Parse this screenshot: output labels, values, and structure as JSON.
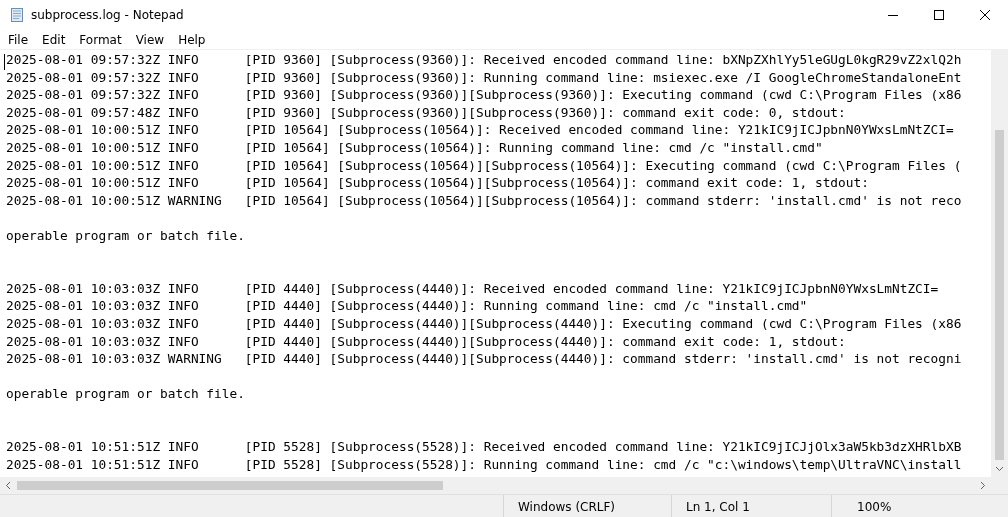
{
  "window": {
    "title": "subprocess.log - Notepad"
  },
  "menu": [
    "File",
    "Edit",
    "Format",
    "View",
    "Help"
  ],
  "editor": {
    "lines": [
      {
        "kind": "text",
        "text": "2025-08-01 09:57:32Z INFO      [PID 9360] [Subprocess(9360)]: Received encoded command line: bXNpZXhlYy5leGUgL0kgR29vZ2xlQ2h"
      },
      {
        "kind": "text",
        "text": "2025-08-01 09:57:32Z INFO      [PID 9360] [Subprocess(9360)]: Running command line: msiexec.exe /I GoogleChromeStandaloneEnt"
      },
      {
        "kind": "text",
        "text": "2025-08-01 09:57:32Z INFO      [PID 9360] [Subprocess(9360)][Subprocess(9360)]: Executing command (cwd C:\\Program Files (x86"
      },
      {
        "kind": "text",
        "text": "2025-08-01 09:57:48Z INFO      [PID 9360] [Subprocess(9360)][Subprocess(9360)]: command exit code: 0, stdout:"
      },
      {
        "kind": "text",
        "text": "2025-08-01 10:00:51Z INFO      [PID 10564] [Subprocess(10564)]: Received encoded command line: Y21kIC9jICJpbnN0YWxsLmNtZCI="
      },
      {
        "kind": "text",
        "text": "2025-08-01 10:00:51Z INFO      [PID 10564] [Subprocess(10564)]: Running command line: cmd /c \"install.cmd\""
      },
      {
        "kind": "text",
        "text": "2025-08-01 10:00:51Z INFO      [PID 10564] [Subprocess(10564)][Subprocess(10564)]: Executing command (cwd C:\\Program Files ("
      },
      {
        "kind": "text",
        "text": "2025-08-01 10:00:51Z INFO      [PID 10564] [Subprocess(10564)][Subprocess(10564)]: command exit code: 1, stdout:"
      },
      {
        "kind": "text",
        "text": "2025-08-01 10:00:51Z WARNING   [PID 10564] [Subprocess(10564)][Subprocess(10564)]: command stderr: 'install.cmd' is not reco"
      },
      {
        "kind": "blank"
      },
      {
        "kind": "text",
        "text": "operable program or batch file."
      },
      {
        "kind": "blank"
      },
      {
        "kind": "blank"
      },
      {
        "kind": "text",
        "text": "2025-08-01 10:03:03Z INFO      [PID 4440] [Subprocess(4440)]: Received encoded command line: Y21kIC9jICJpbnN0YWxsLmNtZCI="
      },
      {
        "kind": "text",
        "text": "2025-08-01 10:03:03Z INFO      [PID 4440] [Subprocess(4440)]: Running command line: cmd /c \"install.cmd\""
      },
      {
        "kind": "text",
        "text": "2025-08-01 10:03:03Z INFO      [PID 4440] [Subprocess(4440)][Subprocess(4440)]: Executing command (cwd C:\\Program Files (x86"
      },
      {
        "kind": "text",
        "text": "2025-08-01 10:03:03Z INFO      [PID 4440] [Subprocess(4440)][Subprocess(4440)]: command exit code: 1, stdout:"
      },
      {
        "kind": "text",
        "text": "2025-08-01 10:03:03Z WARNING   [PID 4440] [Subprocess(4440)][Subprocess(4440)]: command stderr: 'install.cmd' is not recogni"
      },
      {
        "kind": "blank"
      },
      {
        "kind": "text",
        "text": "operable program or batch file."
      },
      {
        "kind": "blank"
      },
      {
        "kind": "blank"
      },
      {
        "kind": "text",
        "text": "2025-08-01 10:51:51Z INFO      [PID 5528] [Subprocess(5528)]: Received encoded command line: Y21kIC9jICJjOlx3aW5kb3dzXHRlbXB"
      },
      {
        "kind": "text",
        "text": "2025-08-01 10:51:51Z INFO      [PID 5528] [Subprocess(5528)]: Running command line: cmd /c \"c:\\windows\\temp\\UltraVNC\\install"
      }
    ]
  },
  "status_bar": {
    "line_ending": "Windows (CRLF)",
    "position": "Ln 1, Col 1",
    "zoom": "100%"
  }
}
